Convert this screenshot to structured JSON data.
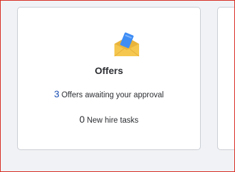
{
  "offers_card": {
    "title": "Offers",
    "offers_count": "3",
    "offers_label": "Offers awaiting your approval",
    "tasks_count": "0",
    "tasks_label": "New hire tasks",
    "icon": "envelope-icon"
  },
  "colors": {
    "accent": "#1a4fb3",
    "envelope": "#f5c74f",
    "letter": "#3e8df5",
    "background": "#f0f2f5",
    "frame_border": "#d9261c"
  }
}
